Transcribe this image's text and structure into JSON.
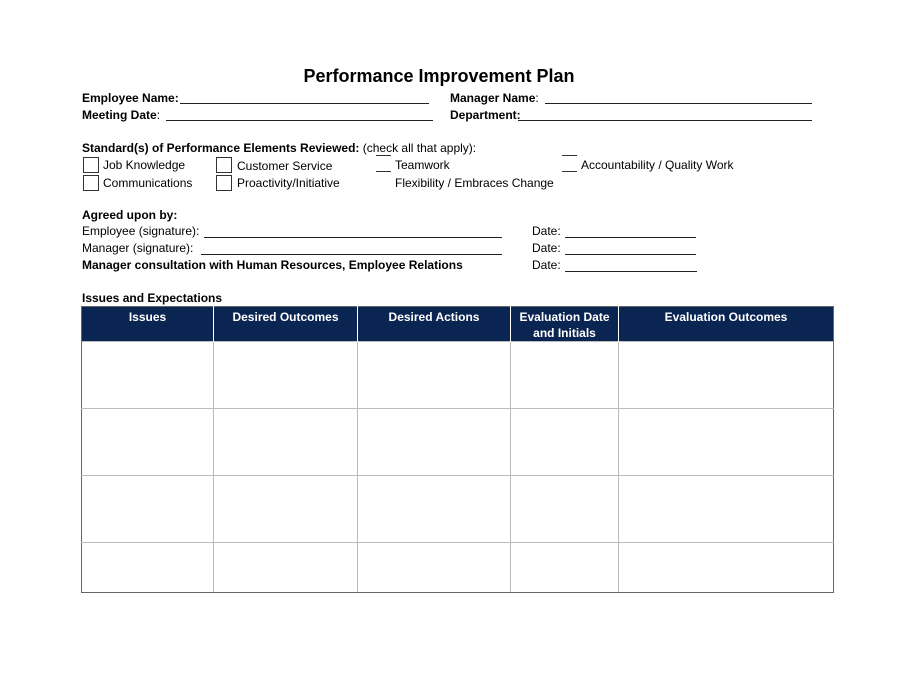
{
  "title": "Performance Improvement Plan",
  "header_fields": {
    "employee_name_label": "Employee Name:",
    "meeting_date_label": "Meeting  Date",
    "meeting_date_colon": ":",
    "manager_name_label": "Manager Name",
    "manager_name_colon": ":",
    "department_label": "Department:"
  },
  "standards": {
    "heading": "Standard(s) of Performance Elements Reviewed:",
    "instruction": " (check all that apply):",
    "items": [
      {
        "label": "Job Knowledge",
        "checked": false
      },
      {
        "label": "Customer Service",
        "checked": false
      },
      {
        "label": "Teamwork",
        "checked": false
      },
      {
        "label": "Accountability / Quality Work",
        "checked": false
      },
      {
        "label": "Communications",
        "checked": false
      },
      {
        "label": "Proactivity/Initiative",
        "checked": false
      },
      {
        "label": "Flexibility / Embraces Change",
        "checked": false
      }
    ]
  },
  "agreement": {
    "heading": "Agreed upon by:",
    "employee_sig_label": "Employee (signature):",
    "manager_sig_label": "Manager  (signature):",
    "hr_consult_label": "Manager consultation with Human Resources, Employee Relations",
    "date_label": "Date:"
  },
  "issues_table": {
    "heading": "Issues and Expectations",
    "columns": [
      "Issues",
      "Desired Outcomes",
      "Desired Actions",
      "Evaluation Date and Initials",
      "Evaluation Outcomes"
    ],
    "column_lines": [
      [
        "Issues"
      ],
      [
        "Desired Outcomes"
      ],
      [
        "Desired Actions"
      ],
      [
        "Evaluation Date",
        "and Initials"
      ],
      [
        "Evaluation Outcomes"
      ]
    ],
    "rows": [
      [
        "",
        "",
        "",
        "",
        ""
      ],
      [
        "",
        "",
        "",
        "",
        ""
      ],
      [
        "",
        "",
        "",
        "",
        ""
      ],
      [
        "",
        "",
        "",
        "",
        ""
      ]
    ]
  },
  "colors": {
    "table_header_bg": "#0b2552",
    "table_header_text": "#ffffff"
  }
}
